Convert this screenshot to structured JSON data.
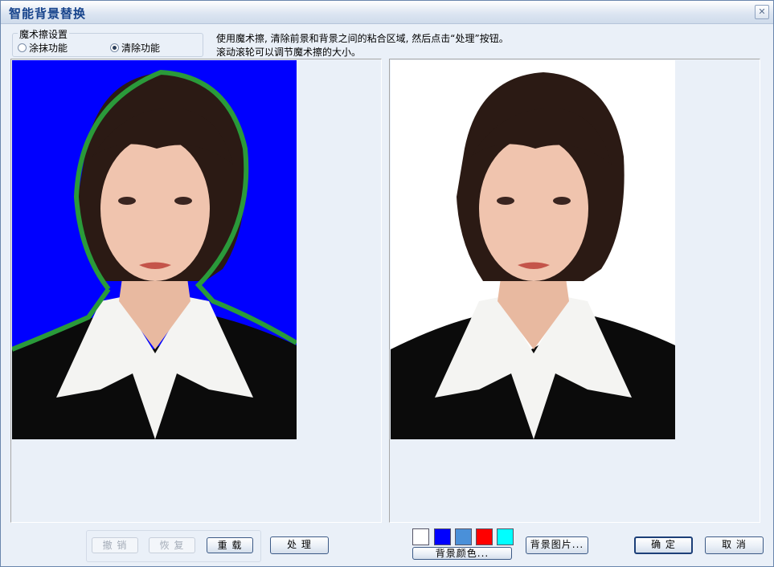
{
  "window": {
    "title": "智能背景替换",
    "close_glyph": "✕"
  },
  "settings": {
    "group_label": "魔术擦设置",
    "options": [
      {
        "label": "涂抹功能",
        "checked": false
      },
      {
        "label": "清除功能",
        "checked": true
      }
    ]
  },
  "instructions": {
    "line1": "使用魔术擦, 清除前景和背景之间的粘合区域, 然后点击“处理”按钮。",
    "line2": "滚动滚轮可以调节魔术擦的大小。"
  },
  "buttons": {
    "undo": "撤 销",
    "redo": "恢 复",
    "reload": "重 载",
    "process": "处 理",
    "bg_color": "背景颜色...",
    "bg_image": "背景图片...",
    "ok": "确 定",
    "cancel": "取 消"
  },
  "colors": {
    "source_bg": "#0000ff",
    "result_bg": "#ffffff",
    "mask_outline": "#2a9a3a",
    "swatches": [
      "#ffffff",
      "#0000ff",
      "#4a90d9",
      "#ff0000",
      "#00ffff"
    ]
  },
  "icons": {
    "close": "close-icon"
  }
}
